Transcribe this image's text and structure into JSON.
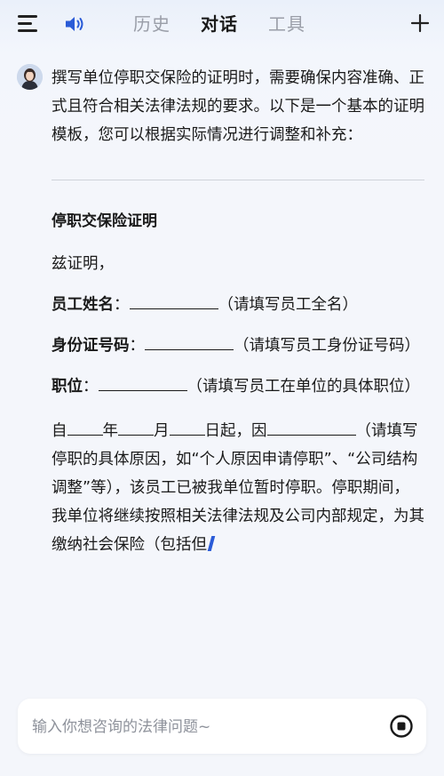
{
  "header": {
    "tabs": [
      {
        "label": "历史",
        "active": false
      },
      {
        "label": "对话",
        "active": true
      },
      {
        "label": "工具",
        "active": false
      }
    ],
    "icons": {
      "menu": "menu-icon",
      "speaker": "speaker-icon",
      "new": "plus-icon"
    }
  },
  "colors": {
    "accent_blue": "#2a5bd7",
    "text": "#1a1a1a",
    "muted": "#9a9ea8"
  },
  "message": {
    "intro": "撰写单位停职交保险的证明时，需要确保内容准确、正式且符合相关法律法规的要求。以下是一个基本的证明模板，您可以根据实际情况进行调整和补充：",
    "doc_title": "停职交保险证明",
    "salutation": "兹证明，",
    "fields": [
      {
        "label": "员工姓名",
        "hint": "（请填写员工全名）"
      },
      {
        "label": "身份证号码",
        "hint": "（请填写员工身份证号码）"
      },
      {
        "label": "职位",
        "hint": "（请填写员工在单位的具体职位）"
      }
    ],
    "colon": "：",
    "body": {
      "t1": "自",
      "t2": "年",
      "t3": "月",
      "t4": "日起，因",
      "t5": "（请填写停职的具体原因，如“个人原因申请停职”、“公司结构调整”等），该员工已被我单位暂时停职。停职期间，我单位将继续按照相关法律法规及公司内部规定，为其缴纳社会保险（包括但"
    }
  },
  "input": {
    "placeholder": "输入你想咨询的法律问题~",
    "value": ""
  }
}
